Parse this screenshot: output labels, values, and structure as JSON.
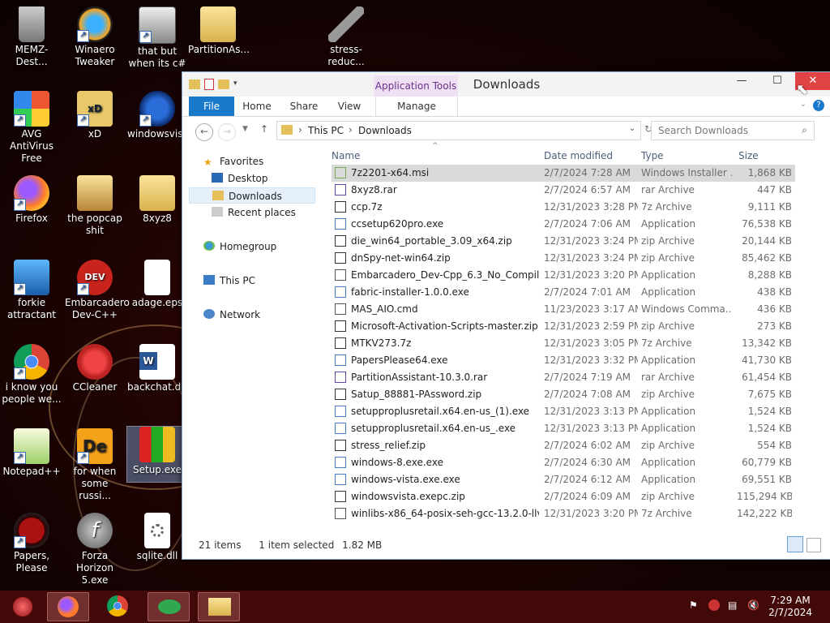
{
  "desktop": {
    "icons": [
      {
        "label": "MEMZ-Dest...",
        "icon": "recycle-bin-icon"
      },
      {
        "label": "Winaero Tweaker",
        "icon": "winaero-icon"
      },
      {
        "label": "that but when its c#",
        "icon": "windows-stack-icon"
      },
      {
        "label": "PartitionAs...",
        "icon": "folder-icon"
      },
      {
        "label": "stress-reduc...",
        "icon": "hammer-icon"
      },
      {
        "label": "AVG AntiVirus Free",
        "icon": "avg-icon"
      },
      {
        "label": "xD",
        "icon": "xd-icon"
      },
      {
        "label": "windowsvista",
        "icon": "windows-vista-icon"
      },
      {
        "label": "Firefox",
        "icon": "firefox-icon"
      },
      {
        "label": "the popcap shit",
        "icon": "folder-icon"
      },
      {
        "label": "8xyz8",
        "icon": "folder-icon"
      },
      {
        "label": "forkie attractant",
        "icon": "computer-gear-icon"
      },
      {
        "label": "Embarcadero Dev-C++",
        "icon": "devcpp-icon"
      },
      {
        "label": "adage.eps",
        "icon": "blank-file-icon"
      },
      {
        "label": "i know you people we...",
        "icon": "chrome-icon"
      },
      {
        "label": "CCleaner",
        "icon": "ccleaner-icon"
      },
      {
        "label": "backchat.d...",
        "icon": "word-icon"
      },
      {
        "label": "Notepad++",
        "icon": "notepadpp-icon"
      },
      {
        "label": "for when some russi...",
        "icon": "de-icon"
      },
      {
        "label": "Setup.exe",
        "icon": "setup-chart-icon"
      },
      {
        "label": "Papers, Please",
        "icon": "papers-please-icon"
      },
      {
        "label": "Forza Horizon 5.exe",
        "icon": "flash-icon"
      },
      {
        "label": "sqlite.dll",
        "icon": "dll-gear-icon"
      }
    ]
  },
  "window": {
    "title": "Downloads",
    "context_group": "Application Tools",
    "ribbon_tabs": [
      "File",
      "Home",
      "Share",
      "View",
      "Manage"
    ],
    "address": {
      "crumbs": [
        "This PC",
        "Downloads"
      ]
    },
    "search_placeholder": "Search Downloads",
    "nav": {
      "favorites": "Favorites",
      "items": [
        "Desktop",
        "Downloads",
        "Recent places"
      ],
      "homegroup": "Homegroup",
      "thispc": "This PC",
      "network": "Network"
    },
    "columns": {
      "name": "Name",
      "date": "Date modified",
      "type": "Type",
      "size": "Size"
    },
    "files": [
      {
        "name": "7z2201-x64.msi",
        "date": "2/7/2024 7:28 AM",
        "type": "Windows Installer ...",
        "size": "1,868 KB",
        "sel": true
      },
      {
        "name": "8xyz8.rar",
        "date": "2/7/2024 6:57 AM",
        "type": "rar Archive",
        "size": "447 KB"
      },
      {
        "name": "ccp.7z",
        "date": "12/31/2023 3:28 PM",
        "type": "7z Archive",
        "size": "9,111 KB"
      },
      {
        "name": "ccsetup620pro.exe",
        "date": "2/7/2024 7:06 AM",
        "type": "Application",
        "size": "76,538 KB"
      },
      {
        "name": "die_win64_portable_3.09_x64.zip",
        "date": "12/31/2023 3:24 PM",
        "type": "zip Archive",
        "size": "20,144 KB"
      },
      {
        "name": "dnSpy-net-win64.zip",
        "date": "12/31/2023 3:24 PM",
        "type": "zip Archive",
        "size": "85,462 KB"
      },
      {
        "name": "Embarcadero_Dev-Cpp_6.3_No_Compiler...",
        "date": "12/31/2023 3:20 PM",
        "type": "Application",
        "size": "8,288 KB"
      },
      {
        "name": "fabric-installer-1.0.0.exe",
        "date": "2/7/2024 7:01 AM",
        "type": "Application",
        "size": "438 KB"
      },
      {
        "name": "MAS_AIO.cmd",
        "date": "11/23/2023 3:17 AM",
        "type": "Windows Comma...",
        "size": "436 KB"
      },
      {
        "name": "Microsoft-Activation-Scripts-master.zip",
        "date": "12/31/2023 2:59 PM",
        "type": "zip Archive",
        "size": "273 KB"
      },
      {
        "name": "MTKV273.7z",
        "date": "12/31/2023 3:05 PM",
        "type": "7z Archive",
        "size": "13,342 KB"
      },
      {
        "name": "PapersPlease64.exe",
        "date": "12/31/2023 3:32 PM",
        "type": "Application",
        "size": "41,730 KB"
      },
      {
        "name": "PartitionAssistant-10.3.0.rar",
        "date": "2/7/2024 7:19 AM",
        "type": "rar Archive",
        "size": "61,454 KB"
      },
      {
        "name": "Satup_88881-PAssword.zip",
        "date": "2/7/2024 7:08 AM",
        "type": "zip Archive",
        "size": "7,675 KB"
      },
      {
        "name": "setupproplusretail.x64.en-us_(1).exe",
        "date": "12/31/2023 3:13 PM",
        "type": "Application",
        "size": "1,524 KB"
      },
      {
        "name": "setupproplusretail.x64.en-us_.exe",
        "date": "12/31/2023 3:13 PM",
        "type": "Application",
        "size": "1,524 KB"
      },
      {
        "name": "stress_relief.zip",
        "date": "2/7/2024 6:02 AM",
        "type": "zip Archive",
        "size": "554 KB"
      },
      {
        "name": "windows-8.exe.exe",
        "date": "2/7/2024 6:30 AM",
        "type": "Application",
        "size": "60,779 KB"
      },
      {
        "name": "windows-vista.exe.exe",
        "date": "2/7/2024 6:12 AM",
        "type": "Application",
        "size": "69,551 KB"
      },
      {
        "name": "windowsvista.exepc.zip",
        "date": "2/7/2024 6:09 AM",
        "type": "zip Archive",
        "size": "115,294 KB"
      },
      {
        "name": "winlibs-x86_64-posix-seh-gcc-13.2.0-llv...",
        "date": "12/31/2023 3:20 PM",
        "type": "7z Archive",
        "size": "142,222 KB"
      }
    ],
    "status": {
      "count": "21 items",
      "selected": "1 item selected",
      "size": "1.82 MB"
    }
  },
  "taskbar": {
    "time": "7:29 AM",
    "date": "2/7/2024",
    "apps": [
      "start-orb-icon",
      "firefox-icon",
      "chrome-icon",
      "chat-app-icon",
      "file-explorer-icon"
    ]
  }
}
